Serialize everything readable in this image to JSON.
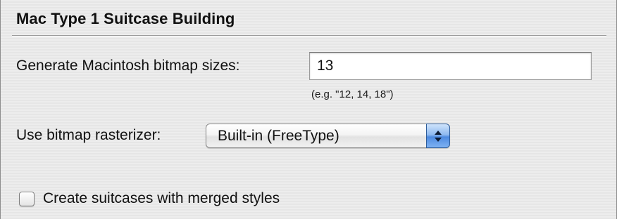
{
  "section": {
    "title": "Mac Type 1 Suitcase Building"
  },
  "bitmap_sizes": {
    "label": "Generate Macintosh bitmap sizes:",
    "value": "13",
    "hint": "(e.g. \"12, 14, 18\")"
  },
  "rasterizer": {
    "label": "Use bitmap rasterizer:",
    "selected": "Built-in (FreeType)",
    "arrows_icon": "up-down-arrows-icon",
    "accent_color": "#4d8ae0"
  },
  "merged_styles": {
    "label": "Create suitcases with merged styles",
    "checked": false
  }
}
